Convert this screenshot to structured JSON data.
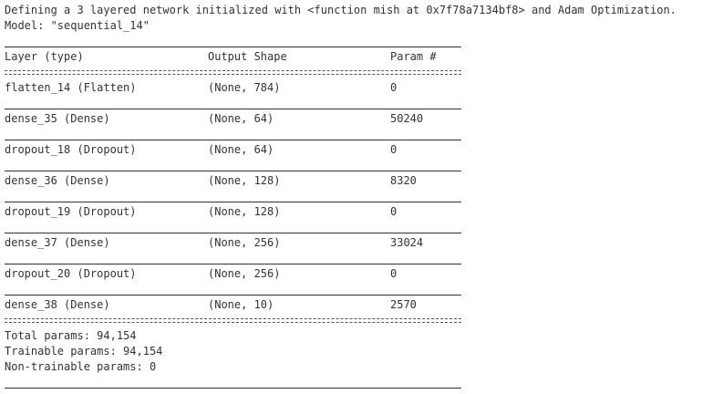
{
  "intro_line": "Defining a 3 layered network initialized with <function mish at 0x7f78a7134bf8> and Adam Optimization.",
  "model_line": "Model: \"sequential_14\"",
  "headers": {
    "layer": "Layer (type)",
    "shape": "Output Shape",
    "params": "Param #"
  },
  "layers": [
    {
      "layer": "flatten_14 (Flatten)",
      "shape": "(None, 784)",
      "params": "0"
    },
    {
      "layer": "dense_35 (Dense)",
      "shape": "(None, 64)",
      "params": "50240"
    },
    {
      "layer": "dropout_18 (Dropout)",
      "shape": "(None, 64)",
      "params": "0"
    },
    {
      "layer": "dense_36 (Dense)",
      "shape": "(None, 128)",
      "params": "8320"
    },
    {
      "layer": "dropout_19 (Dropout)",
      "shape": "(None, 128)",
      "params": "0"
    },
    {
      "layer": "dense_37 (Dense)",
      "shape": "(None, 256)",
      "params": "33024"
    },
    {
      "layer": "dropout_20 (Dropout)",
      "shape": "(None, 256)",
      "params": "0"
    },
    {
      "layer": "dense_38 (Dense)",
      "shape": "(None, 10)",
      "params": "2570"
    }
  ],
  "totals": {
    "total": "Total params: 94,154",
    "trainable": "Trainable params: 94,154",
    "non_trainable": "Non-trainable params: 0"
  }
}
